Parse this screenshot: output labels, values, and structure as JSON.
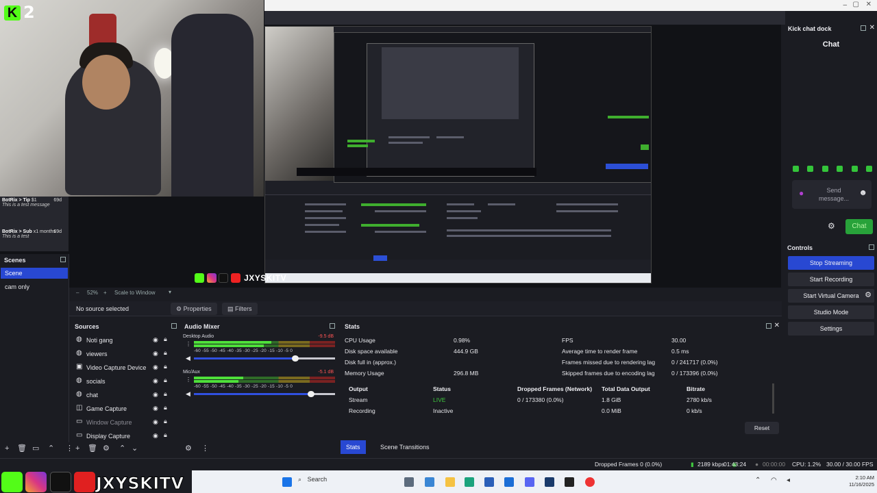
{
  "overlay": {
    "kick_count": "2",
    "brand_name": "JXYSKITV",
    "chat_messages": [
      {
        "user": "BotRix > Tip",
        "amount": "$1",
        "text": "This is a test message",
        "age": "69d"
      },
      {
        "user": "BotRix > Sub",
        "amount": "x1 months",
        "text": "This is a test",
        "age": "69d"
      }
    ]
  },
  "preview": {
    "zoom": "52%",
    "scale_mode": "Scale to Window"
  },
  "source_toolbar": {
    "selection": "No source selected",
    "properties_label": "Properties",
    "filters_label": "Filters"
  },
  "scenes": {
    "title": "Scenes",
    "items": [
      {
        "label": "Scene",
        "active": true
      },
      {
        "label": "cam only",
        "active": false
      }
    ]
  },
  "sources": {
    "title": "Sources",
    "items": [
      {
        "label": "Noti gang",
        "icon": "globe-icon"
      },
      {
        "label": "viewers",
        "icon": "globe-icon"
      },
      {
        "label": "Video Capture Device",
        "icon": "camera-icon"
      },
      {
        "label": "socials",
        "icon": "globe-icon"
      },
      {
        "label": "chat",
        "icon": "globe-icon"
      },
      {
        "label": "Game Capture",
        "icon": "gamepad-icon"
      },
      {
        "label": "Window Capture",
        "icon": "window-icon"
      },
      {
        "label": "Display Capture",
        "icon": "monitor-icon"
      }
    ]
  },
  "audio_mixer": {
    "title": "Audio Mixer",
    "channels": [
      {
        "name": "Desktop Audio",
        "db": "-9.5 dB",
        "level": 0.55,
        "fader": 0.72
      },
      {
        "name": "Mic/Aux",
        "db": "-5.1 dB",
        "level": 0.35,
        "fader": 0.83
      }
    ],
    "ticks": "-60 -55 -50 -45 -40 -35 -30 -25 -20 -15 -10 -5 0"
  },
  "stats": {
    "title": "Stats",
    "left": [
      {
        "label": "CPU Usage",
        "value": "0.98%"
      },
      {
        "label": "Disk space available",
        "value": "444.9 GB"
      },
      {
        "label": "Disk full in (approx.)",
        "value": ""
      },
      {
        "label": "Memory Usage",
        "value": "296.8 MB"
      }
    ],
    "right": [
      {
        "label": "FPS",
        "value": "30.00"
      },
      {
        "label": "Average time to render frame",
        "value": "0.5 ms"
      },
      {
        "label": "Frames missed due to rendering lag",
        "value": "0 / 241717 (0.0%)"
      },
      {
        "label": "Skipped frames due to encoding lag",
        "value": "0 / 173396 (0.0%)"
      }
    ],
    "table_headers": [
      "Output",
      "Status",
      "Dropped Frames (Network)",
      "Total Data Output",
      "Bitrate"
    ],
    "rows": [
      {
        "output": "Stream",
        "status": "LIVE",
        "dropped": "0 / 173380 (0.0%)",
        "total": "1.8 GiB",
        "bitrate": "2780 kb/s"
      },
      {
        "output": "Recording",
        "status": "Inactive",
        "dropped": "",
        "total": "0.0 MiB",
        "bitrate": "0 kb/s"
      }
    ],
    "reset_label": "Reset",
    "live_color": "#3fc83f"
  },
  "bottom_tabs": [
    "Stats",
    "Scene Transitions"
  ],
  "status_bar": {
    "dropped_frames": "Dropped Frames 0 (0.0%)",
    "bitrate": "2189 kbps",
    "stream_time": "01:43:24",
    "rec_time": "00:00:00",
    "cpu": "CPU: 1.2%",
    "fps": "30.00 / 30.00 FPS"
  },
  "chat_dock": {
    "title": "Kick chat dock",
    "heading": "Chat",
    "send_placeholder": "Send message...",
    "chat_button": "Chat"
  },
  "controls": {
    "title": "Controls",
    "buttons": [
      {
        "label": "Stop Streaming",
        "active": true
      },
      {
        "label": "Start Recording",
        "active": false
      },
      {
        "label": "Start Virtual Camera",
        "active": false
      },
      {
        "label": "Studio Mode",
        "active": false
      },
      {
        "label": "Settings",
        "active": false
      }
    ]
  },
  "taskbar": {
    "search_placeholder": "Search",
    "time": "2:10 AM",
    "date": "11/16/2025"
  },
  "colors": {
    "accent": "#2848d2",
    "kick_green": "#53fc18",
    "background": "#1b1c22"
  }
}
